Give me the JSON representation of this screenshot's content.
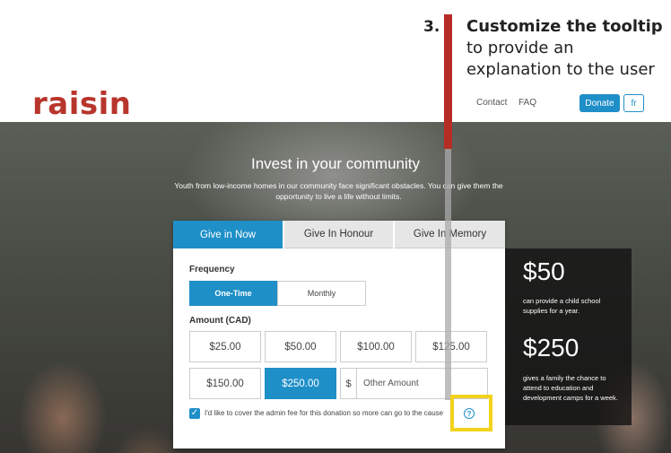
{
  "callout": {
    "number": "3.",
    "bold": "Customize the tooltip",
    "rest": " to provide an explanation to the user"
  },
  "header": {
    "logo": "raisin",
    "nav": {
      "contact": "Contact",
      "faq": "FAQ"
    },
    "donate_label": "Donate",
    "lang_label": "fr"
  },
  "hero": {
    "title": "Invest in your community",
    "subtitle": "Youth from low-income homes in our community face significant obstacles.  You can give them the opportunity to live a life without limits."
  },
  "form": {
    "tabs": [
      "Give in Now",
      "Give In Honour",
      "Give In Memory"
    ],
    "frequency_label": "Frequency",
    "frequency_options": [
      "One-Time",
      "Monthly"
    ],
    "amount_label": "Amount (CAD)",
    "amounts": [
      "$25.00",
      "$50.00",
      "$100.00",
      "$125.00",
      "$150.00",
      "$250.00"
    ],
    "currency_symbol": "$",
    "other_placeholder": "Other Amount",
    "fee_label": "I'd like to cover the admin fee for this donation so more can go to the cause",
    "help_icon_glyph": "?"
  },
  "impact": {
    "items": [
      {
        "amount": "$50",
        "text": "can provide a child school supplies for a year."
      },
      {
        "amount": "$250",
        "text": "gives a family the chance to attend to education and development camps for a week."
      }
    ]
  },
  "colors": {
    "accent": "#1f8fc8",
    "brand": "#b8352c",
    "highlight": "#f2d21a",
    "callout_bar": "#b52d25"
  }
}
